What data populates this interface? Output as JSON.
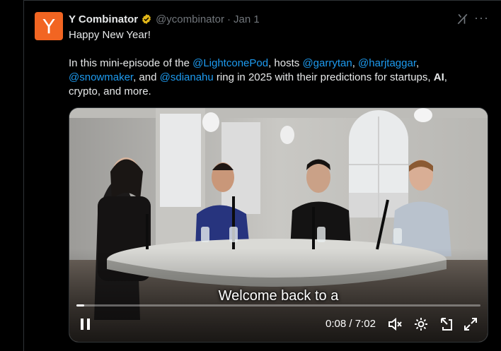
{
  "tweet": {
    "avatar_letter": "Y",
    "author_name": "Y Combinator",
    "handle": "@ycombinator",
    "separator": "·",
    "date": "Jan 1",
    "line1": "Happy New Year!",
    "body": {
      "p1": "In this mini-episode of the ",
      "mention1": "@LightconePod",
      "p2": ", hosts ",
      "mention2": "@garrytan",
      "p3": ", ",
      "mention3": "@harjtaggar",
      "p4": ",",
      "mention4": "@snowmaker",
      "p5": ", and ",
      "mention5": "@sdianahu",
      "p6": " ring in 2025 with their predictions for startups, ",
      "bold1": "AI",
      "p7": ",",
      "p8": "crypto, and more."
    }
  },
  "video": {
    "caption": "Welcome back to a",
    "current_time": "0:08",
    "total_time": "7:02",
    "time_separator": " / ",
    "progress_fraction": 0.019
  },
  "icons": {
    "verified": "verified-badge-icon",
    "grok": "grok-icon",
    "more": "more-icon",
    "pause": "pause-icon",
    "mute": "volume-muted-icon",
    "settings": "settings-gear-icon",
    "popout": "pop-out-icon",
    "fullscreen": "fullscreen-icon"
  },
  "colors": {
    "background": "#000000",
    "text": "#e7e9ea",
    "secondary": "#71767b",
    "link": "#1d9bf0",
    "avatar": "#f26522",
    "verified": "#e2b719"
  }
}
